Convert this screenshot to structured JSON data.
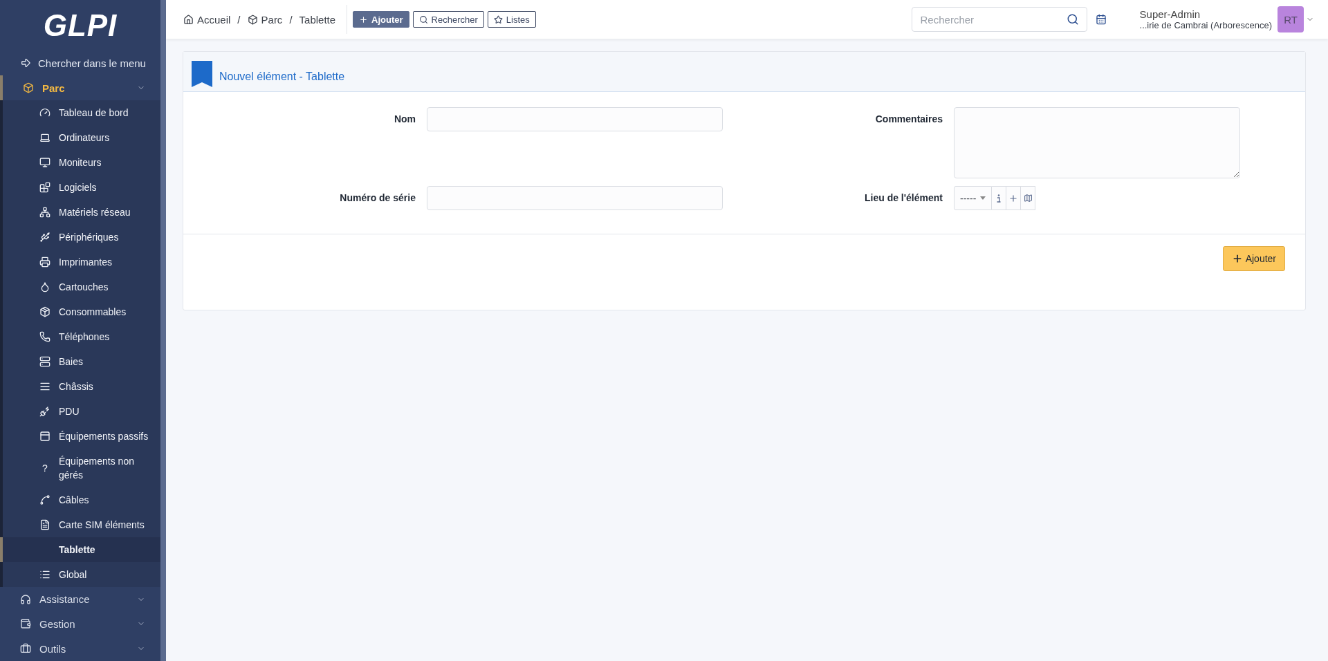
{
  "logo": "GLPI",
  "sidebar": {
    "search_link": "Chercher dans le menu",
    "sections": [
      {
        "label": "Parc",
        "expanded": true,
        "selected": true,
        "items": [
          {
            "label": "Tableau de bord",
            "selected": false
          },
          {
            "label": "Ordinateurs",
            "selected": false
          },
          {
            "label": "Moniteurs",
            "selected": false
          },
          {
            "label": "Logiciels",
            "selected": false
          },
          {
            "label": "Matériels réseau",
            "selected": false
          },
          {
            "label": "Périphériques",
            "selected": false
          },
          {
            "label": "Imprimantes",
            "selected": false
          },
          {
            "label": "Cartouches",
            "selected": false
          },
          {
            "label": "Consommables",
            "selected": false
          },
          {
            "label": "Téléphones",
            "selected": false
          },
          {
            "label": "Baies",
            "selected": false
          },
          {
            "label": "Châssis",
            "selected": false
          },
          {
            "label": "PDU",
            "selected": false
          },
          {
            "label": "Équipements passifs",
            "selected": false
          },
          {
            "label": "Équipements non gérés",
            "selected": false,
            "glyph": "?"
          },
          {
            "label": "Câbles",
            "selected": false
          },
          {
            "label": "Carte SIM éléments",
            "selected": false
          },
          {
            "label": "Tablette",
            "selected": true
          },
          {
            "label": "Global",
            "selected": false
          }
        ]
      },
      {
        "label": "Assistance",
        "expanded": false,
        "selected": false
      },
      {
        "label": "Gestion",
        "expanded": false,
        "selected": false
      },
      {
        "label": "Outils",
        "expanded": false,
        "selected": false
      }
    ]
  },
  "topbar": {
    "breadcrumbs": [
      "Accueil",
      "Parc",
      "Tablette"
    ],
    "breadcrumb_separator": "/",
    "actions": [
      {
        "label": "Ajouter",
        "kind": "primary"
      },
      {
        "label": "Rechercher",
        "kind": "outline"
      },
      {
        "label": "Listes",
        "kind": "outline"
      }
    ],
    "search": {
      "placeholder": "Rechercher"
    },
    "user": {
      "name": "Super-Admin",
      "entity": "...irie de Cambrai (Arborescence)",
      "initials": "RT",
      "color": "#b984dd"
    }
  },
  "form": {
    "title": "Nouvel élément - Tablette",
    "fields": [
      {
        "label": "Nom",
        "kind": "text"
      },
      {
        "label": "Commentaires",
        "kind": "textarea"
      },
      {
        "label": "Numéro de série",
        "kind": "text"
      },
      {
        "label": "Lieu de l'élément",
        "kind": "dropdown",
        "value": "-----"
      }
    ],
    "submit": "Ajouter"
  }
}
